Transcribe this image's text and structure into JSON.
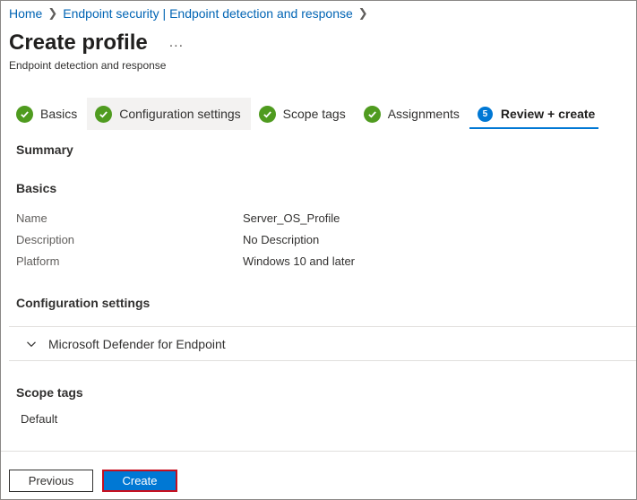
{
  "breadcrumb": {
    "home": "Home",
    "endpoint": "Endpoint security | Endpoint detection and response"
  },
  "page": {
    "title": "Create profile",
    "more": "...",
    "subtitle": "Endpoint detection and response"
  },
  "steps": [
    {
      "label": "Basics",
      "status": "complete"
    },
    {
      "label": "Configuration settings",
      "status": "complete"
    },
    {
      "label": "Scope tags",
      "status": "complete"
    },
    {
      "label": "Assignments",
      "status": "complete"
    },
    {
      "label": "Review + create",
      "status": "current",
      "number": "5"
    }
  ],
  "summary": {
    "heading": "Summary",
    "basics": {
      "heading": "Basics",
      "rows": [
        {
          "label": "Name",
          "value": "Server_OS_Profile"
        },
        {
          "label": "Description",
          "value": "No Description"
        },
        {
          "label": "Platform",
          "value": "Windows 10 and later"
        }
      ]
    },
    "configuration": {
      "heading": "Configuration settings",
      "accordion_label": "Microsoft Defender for Endpoint"
    },
    "scope_tags": {
      "heading": "Scope tags",
      "value": "Default"
    }
  },
  "footer": {
    "previous_label": "Previous",
    "create_label": "Create"
  },
  "colors": {
    "link": "#0064b4",
    "accent": "#0078d4",
    "success": "#4f9b1f",
    "highlight_border": "#c50f1f"
  }
}
